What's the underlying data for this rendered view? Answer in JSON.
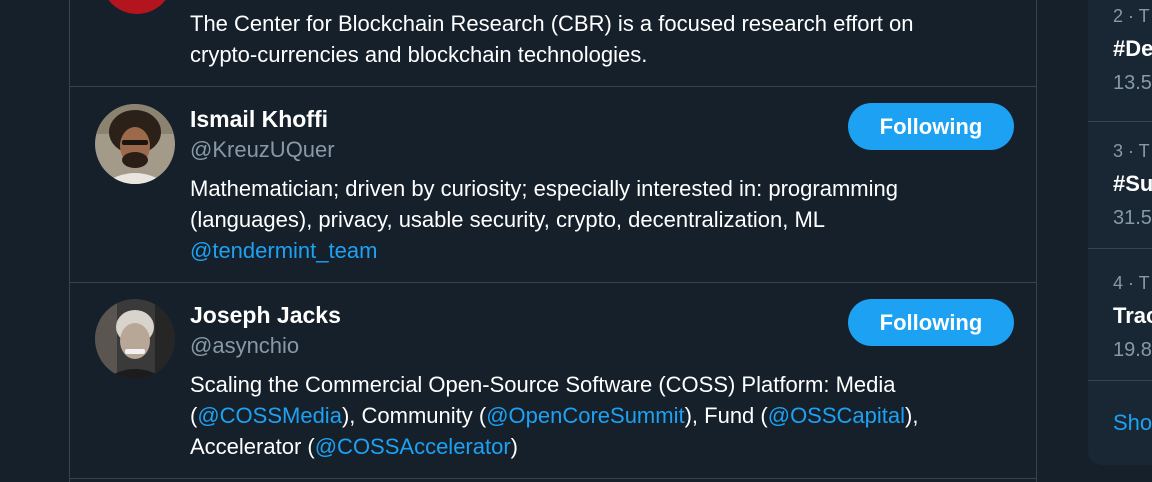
{
  "feed": {
    "cards": [
      {
        "bio_lines": [
          [
            {
              "t": "The Center for Blockchain Research (CBR) is a focused research effort on"
            }
          ],
          [
            {
              "t": "crypto-currencies and blockchain technologies."
            }
          ]
        ]
      },
      {
        "name": "Ismail Khoffi",
        "handle": "@KreuzUQuer",
        "button": "Following",
        "bio_lines": [
          [
            {
              "t": "Mathematician; driven by curiosity; especially interested in: programming"
            }
          ],
          [
            {
              "t": "(languages), privacy, usable security, crypto, decentralization, ML"
            }
          ],
          [
            {
              "t": "@tendermint_team",
              "link": true
            }
          ]
        ]
      },
      {
        "name": "Joseph Jacks",
        "handle": "@asynchio",
        "button": "Following",
        "bio_lines": [
          [
            {
              "t": "Scaling the Commercial Open-Source Software (COSS) Platform: Media"
            }
          ],
          [
            {
              "t": "("
            },
            {
              "t": "@COSSMedia",
              "link": true
            },
            {
              "t": "), Community ("
            },
            {
              "t": "@OpenCoreSummit",
              "link": true
            },
            {
              "t": "), Fund ("
            },
            {
              "t": "@OSSCapital",
              "link": true
            },
            {
              "t": "),"
            }
          ],
          [
            {
              "t": "Accelerator ("
            },
            {
              "t": "@COSSAccelerator",
              "link": true
            },
            {
              "t": ")"
            }
          ]
        ]
      }
    ]
  },
  "sidebar": {
    "trends": [
      {
        "meta": "2 · T",
        "name": "#De",
        "count": "13.5"
      },
      {
        "meta": "3 · T",
        "name": "#Su",
        "count": "31.5"
      },
      {
        "meta": "4 · T",
        "name": "Trac",
        "count": "19.8"
      }
    ],
    "show_more": "Sho"
  },
  "colors": {
    "background": "#15202b",
    "card_border": "#38444d",
    "accent": "#1da1f2",
    "secondary_text": "#8899a6",
    "sidebar_bg": "#192734"
  }
}
